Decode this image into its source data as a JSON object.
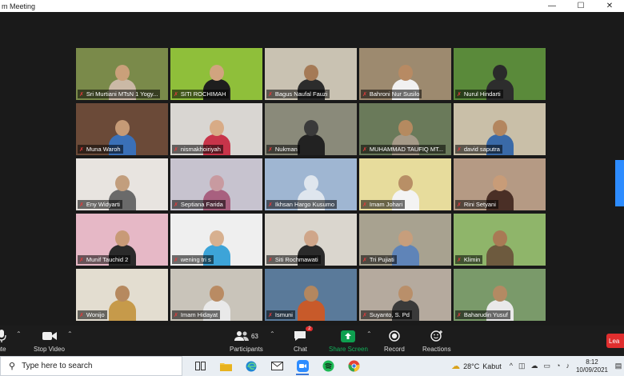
{
  "window": {
    "title": "m Meeting",
    "controls": {
      "minimize": "—",
      "maximize": "☐",
      "close": "✕"
    }
  },
  "accent": "#2d8cff",
  "participants": [
    {
      "name": "Sri Murtiani MTsN 1 Yogy...",
      "bg": "#7a8a4a",
      "skin": "#caa07a",
      "cloth": "#cbb9a6"
    },
    {
      "name": "SITI ROCHIMAH",
      "bg": "#8fbf3a",
      "skin": "#d1a47f",
      "cloth": "#1e1e1e"
    },
    {
      "name": "Bagus Naufal Fauzi",
      "bg": "#c9c2b2",
      "skin": "#a57a56",
      "cloth": "#2c2c2c"
    },
    {
      "name": "Bahroni Nur Susilo",
      "bg": "#9d8a6f",
      "skin": "#b78a63",
      "cloth": "#f1f1f1"
    },
    {
      "name": "Nurul Hindarti",
      "bg": "#5a8a3a",
      "skin": "#2a2a2a",
      "cloth": "#2d2d2d"
    },
    {
      "name": "Muna Waroh",
      "bg": "#6b4a38",
      "skin": "#c59a76",
      "cloth": "#3a70b8"
    },
    {
      "name": "nismakhoiriyah",
      "bg": "#d9d6d2",
      "skin": "#d8ab86",
      "cloth": "#c8344a"
    },
    {
      "name": "Nukman",
      "bg": "#8a8a7a",
      "skin": "#3a3a3a",
      "cloth": "#222222"
    },
    {
      "name": "MUHAMMAD TAUFIQ MT...",
      "bg": "#6a7a5a",
      "skin": "#b58a60",
      "cloth": "#a69a88"
    },
    {
      "name": "david saputra",
      "bg": "#c9bfa8",
      "skin": "#b3865f",
      "cloth": "#3a6aa8"
    },
    {
      "name": "Eny Widyarti",
      "bg": "#e8e4e0",
      "skin": "#c29e7d",
      "cloth": "#6a6a6a"
    },
    {
      "name": "Septiana Farida",
      "bg": "#c7c3cf",
      "skin": "#c89aa0",
      "cloth": "#a8607f"
    },
    {
      "name": "Ikhsan Hargo Kusumo",
      "bg": "#9fb6d2",
      "skin": "#dfe6ee",
      "cloth": "#dfe6ee"
    },
    {
      "name": "Imam Johari",
      "bg": "#e7dc9c",
      "skin": "#b88f66",
      "cloth": "#f3f3f3"
    },
    {
      "name": "Rini Setyani",
      "bg": "#b59a84",
      "skin": "#c89c78",
      "cloth": "#4a2f26"
    },
    {
      "name": "Munif Tauchid 2",
      "bg": "#e6b8c6",
      "skin": "#c89a77",
      "cloth": "#2a2a2a"
    },
    {
      "name": "wening tri s",
      "bg": "#efefef",
      "skin": "#d7b08f",
      "cloth": "#3da4d8"
    },
    {
      "name": "Siti Rochmawati",
      "bg": "#dad6ce",
      "skin": "#cfa68a",
      "cloth": "#2a2a2a"
    },
    {
      "name": "Tri Pujiati",
      "bg": "#a8a290",
      "skin": "#c79e7c",
      "cloth": "#5f84b8"
    },
    {
      "name": "Klimin",
      "bg": "#8fb56a",
      "skin": "#a97a55",
      "cloth": "#6d5a3e"
    },
    {
      "name": "Wonijo",
      "bg": "#e3ddd0",
      "skin": "#b6895f",
      "cloth": "#c69a4a"
    },
    {
      "name": "Imam Hidayat",
      "bg": "#c9c4ba",
      "skin": "#b98b63",
      "cloth": "#e9e9e9"
    },
    {
      "name": "Ismuni",
      "bg": "#5a7a9a",
      "skin": "#b3875f",
      "cloth": "#c85a2a"
    },
    {
      "name": "Suyanto, S. Pd",
      "bg": "#b5aa9e",
      "skin": "#b98f6a",
      "cloth": "#3a3a3a"
    },
    {
      "name": "Baharudin Yusuf",
      "bg": "#7a9a6a",
      "skin": "#b38a63",
      "cloth": "#e9e9e9"
    }
  ],
  "toolbar": {
    "mute_label": "ute",
    "stop_video_label": "Stop Video",
    "participants_label": "Participants",
    "participants_count": "63",
    "chat_label": "Chat",
    "chat_badge": "2",
    "share_label": "Share Screen",
    "record_label": "Record",
    "reactions_label": "Reactions",
    "leave_label": "Lea"
  },
  "taskbar": {
    "search_placeholder": "Type here to search",
    "weather_temp": "28°C",
    "weather_desc": "Kabut",
    "time": "8:12",
    "date": "10/09/2021"
  }
}
